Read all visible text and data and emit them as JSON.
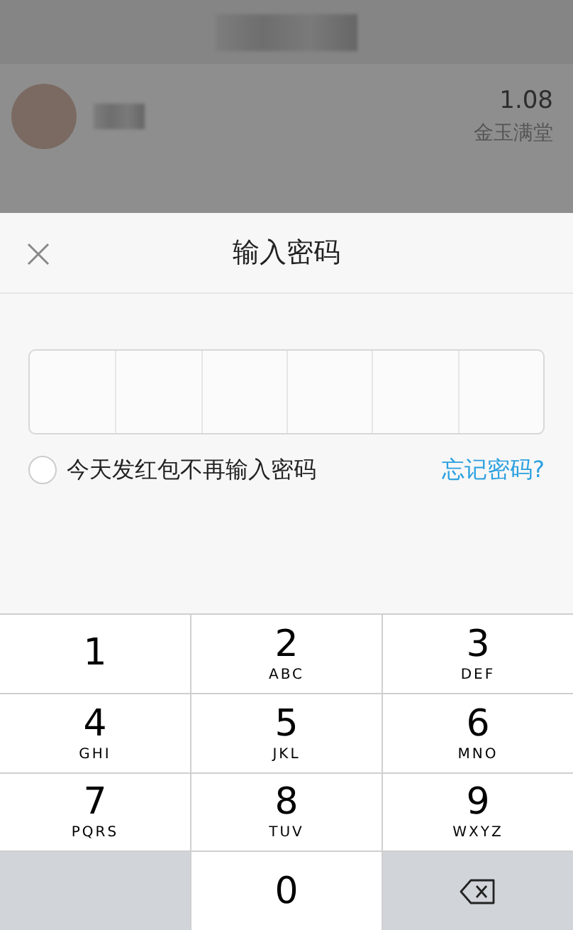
{
  "background": {
    "amount": "1.08",
    "sender_name": "金玉满堂"
  },
  "dialog": {
    "title": "输入密码",
    "password_cells": [
      {
        "filled": false
      },
      {
        "filled": false
      },
      {
        "filled": false
      },
      {
        "filled": false
      },
      {
        "filled": false
      },
      {
        "filled": false
      }
    ],
    "remember": {
      "label": "今天发红包不再输入密码",
      "checked": false
    },
    "forgot_link": "忘记密码?"
  },
  "keypad": {
    "keys": [
      {
        "kind": "digit",
        "digit": "1"
      },
      {
        "kind": "digit",
        "digit": "2",
        "letters": "ABC"
      },
      {
        "kind": "digit",
        "digit": "3",
        "letters": "DEF"
      },
      {
        "kind": "digit",
        "digit": "4",
        "letters": "GHI"
      },
      {
        "kind": "digit",
        "digit": "5",
        "letters": "JKL"
      },
      {
        "kind": "digit",
        "digit": "6",
        "letters": "MNO"
      },
      {
        "kind": "digit",
        "digit": "7",
        "letters": "PQRS"
      },
      {
        "kind": "digit",
        "digit": "8",
        "letters": "TUV"
      },
      {
        "kind": "digit",
        "digit": "9",
        "letters": "WXYZ"
      },
      {
        "kind": "blank"
      },
      {
        "kind": "digit",
        "digit": "0"
      },
      {
        "kind": "delete"
      }
    ]
  }
}
